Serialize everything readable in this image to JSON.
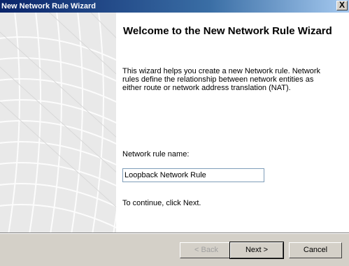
{
  "window": {
    "title": "New Network Rule Wizard",
    "close_glyph": "X"
  },
  "wizard": {
    "heading": "Welcome to the New Network Rule Wizard",
    "description": "This wizard helps you create a new Network rule. Network rules define the relationship between network entities as either route or network address translation (NAT).",
    "name_label": "Network rule name:",
    "name_value": "Loopback Network Rule",
    "continue_text": "To continue, click Next."
  },
  "buttons": {
    "back": "< Back",
    "next": "Next >",
    "cancel": "Cancel"
  }
}
